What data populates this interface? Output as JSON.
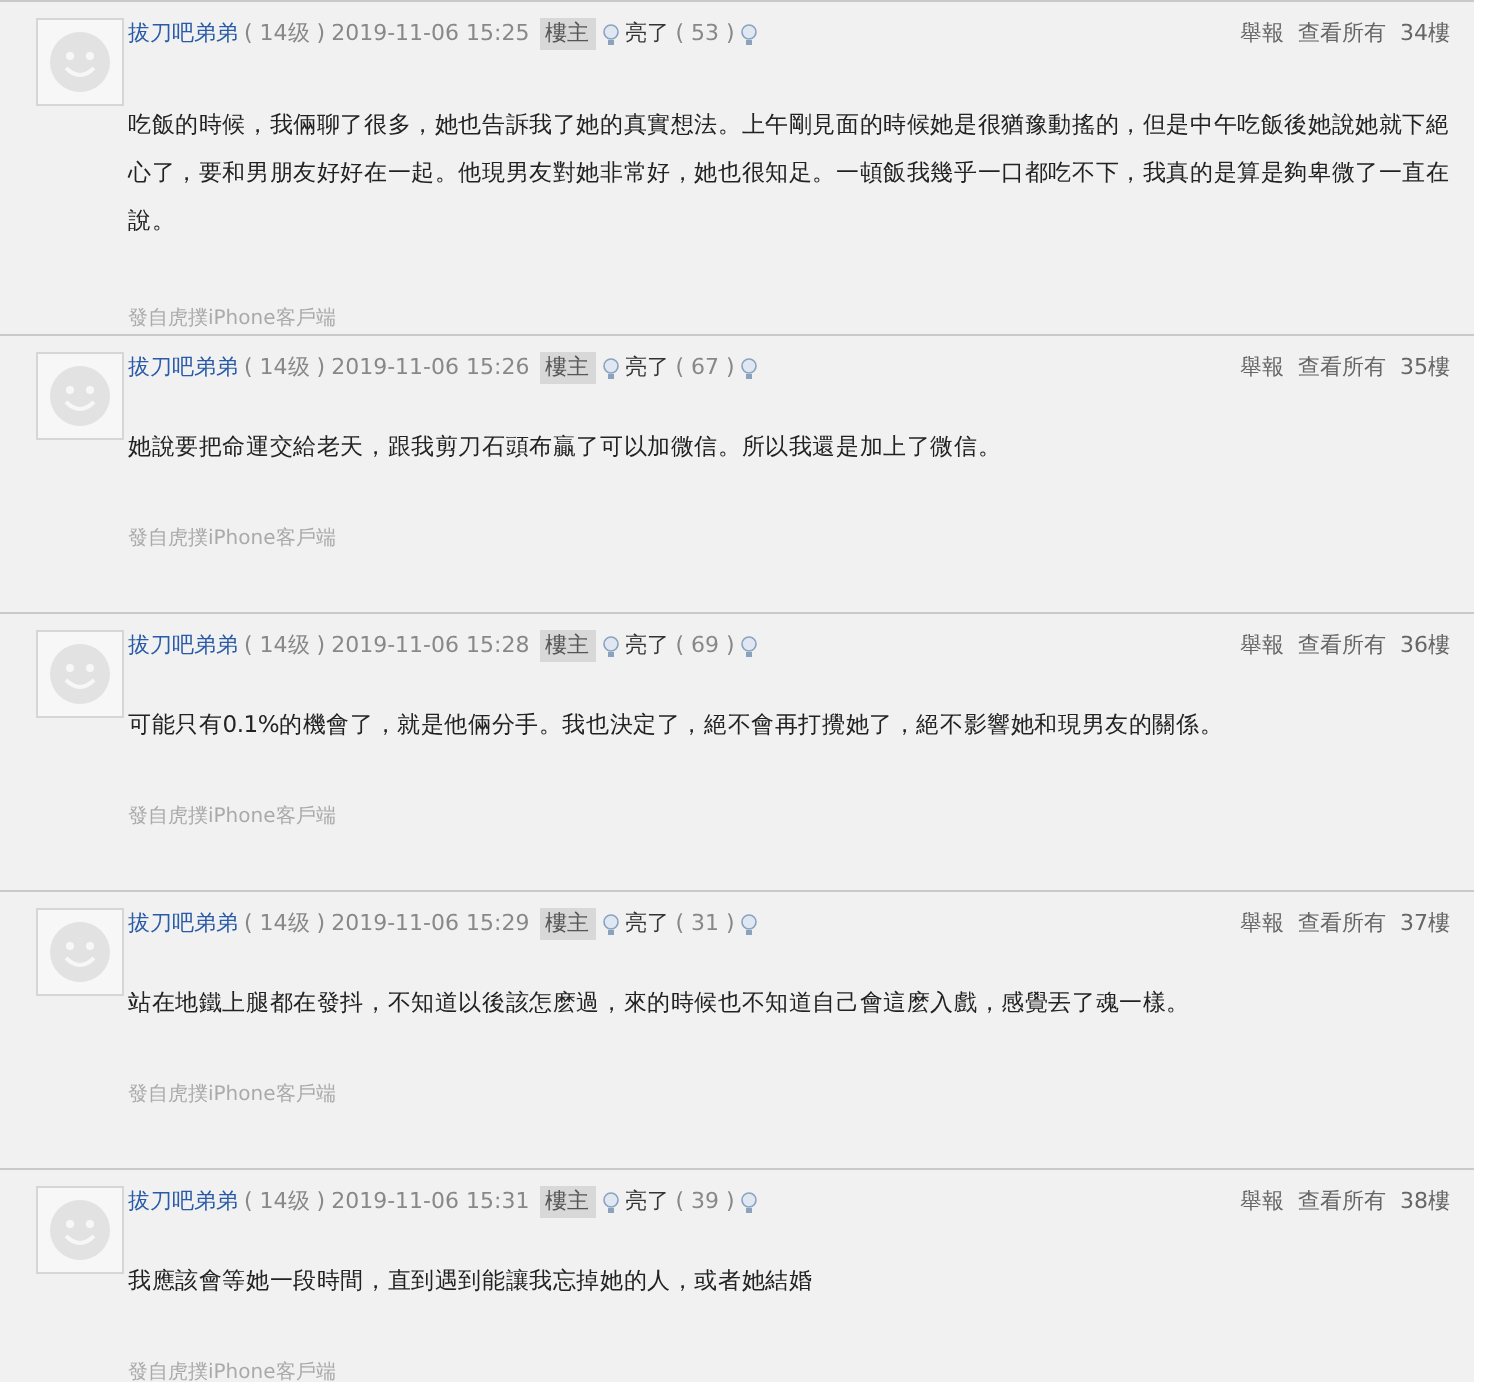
{
  "posts": [
    {
      "author": "拔刀吧弟弟",
      "level": "( 14级 )",
      "time": "2019-11-06 15:25",
      "badge": "樓主",
      "light": "亮了",
      "light_count": "( 53 )",
      "report": "舉報",
      "view_all": "查看所有",
      "floor": "34樓",
      "body": "吃飯的時候，我倆聊了很多，她也告訴我了她的真實想法。上午剛見面的時候她是很猶豫動搖的，但是中午吃飯後她說她就下絕心了，要和男朋友好好在一起。他現男友對她非常好，她也很知足。一頓飯我幾乎一口都吃不下，我真的是算是夠卑微了一直在說。",
      "source": "發自虎撲iPhone客戶端"
    },
    {
      "author": "拔刀吧弟弟",
      "level": "( 14级 )",
      "time": "2019-11-06 15:26",
      "badge": "樓主",
      "light": "亮了",
      "light_count": "( 67 )",
      "report": "舉報",
      "view_all": "查看所有",
      "floor": "35樓",
      "body": "她說要把命運交給老天，跟我剪刀石頭布贏了可以加微信。所以我還是加上了微信。",
      "source": "發自虎撲iPhone客戶端"
    },
    {
      "author": "拔刀吧弟弟",
      "level": "( 14级 )",
      "time": "2019-11-06 15:28",
      "badge": "樓主",
      "light": "亮了",
      "light_count": "( 69 )",
      "report": "舉報",
      "view_all": "查看所有",
      "floor": "36樓",
      "body": "可能只有0.1%的機會了，就是他倆分手。我也決定了，絕不會再打攪她了，絕不影響她和現男友的關係。",
      "source": "發自虎撲iPhone客戶端"
    },
    {
      "author": "拔刀吧弟弟",
      "level": "( 14级 )",
      "time": "2019-11-06 15:29",
      "badge": "樓主",
      "light": "亮了",
      "light_count": "( 31 )",
      "report": "舉報",
      "view_all": "查看所有",
      "floor": "37樓",
      "body": "站在地鐵上腿都在發抖，不知道以後該怎麽過，來的時候也不知道自己會這麽入戲，感覺丟了魂一樣。",
      "source": "發自虎撲iPhone客戶端"
    },
    {
      "author": "拔刀吧弟弟",
      "level": "( 14级 )",
      "time": "2019-11-06 15:31",
      "badge": "樓主",
      "light": "亮了",
      "light_count": "( 39 )",
      "report": "舉報",
      "view_all": "查看所有",
      "floor": "38樓",
      "body": "我應該會等她一段時間，直到遇到能讓我忘掉她的人，或者她結婚",
      "source": "發自虎撲iPhone客戶端"
    }
  ]
}
